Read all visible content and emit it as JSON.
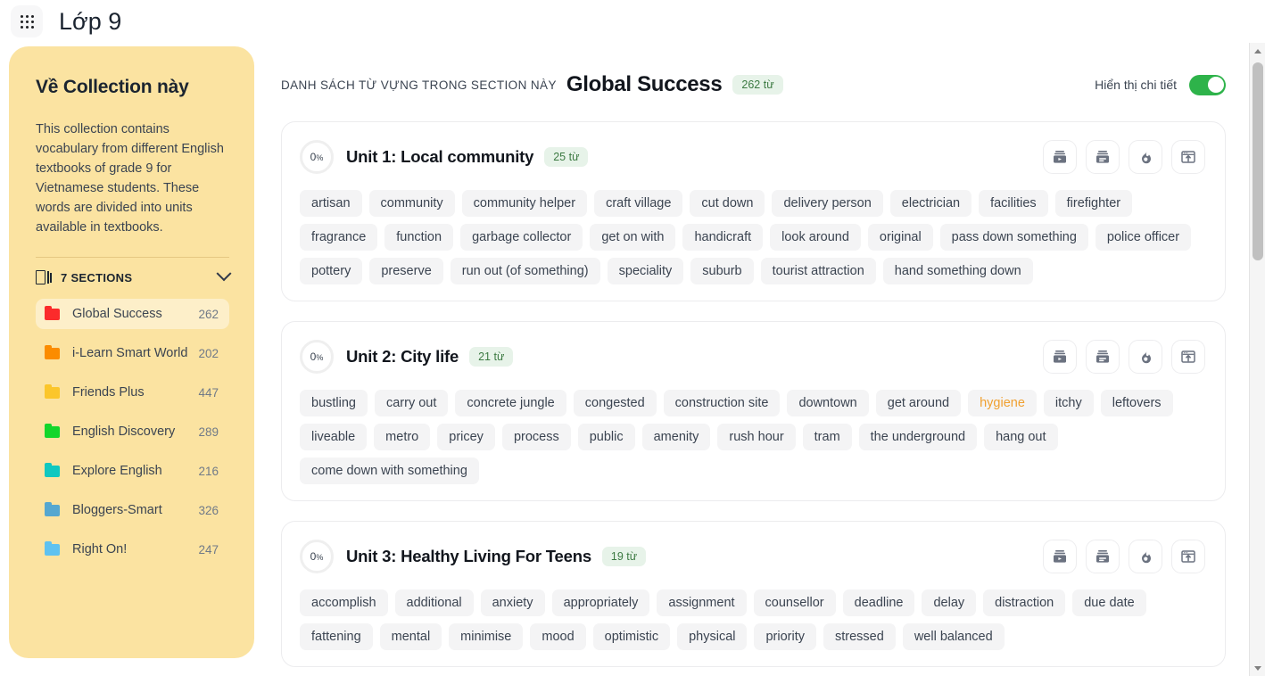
{
  "header": {
    "app_title": "Lớp 9",
    "grid_icon": "grid-apps-icon"
  },
  "sidebar": {
    "title": "Về Collection này",
    "description": "This collection contains vocabulary from different English textbooks of grade 9 for Vietnamese students. These words are divided into units available in textbooks.",
    "sections_label": "7 SECTIONS",
    "sections_icon": "book-sections-icon",
    "chevron_icon": "chevron-down-icon",
    "collections": [
      {
        "name": "Global Success",
        "count": "262",
        "color": "#FB2B2B",
        "active": true
      },
      {
        "name": "i-Learn Smart World",
        "count": "202",
        "color": "#FB8C00",
        "active": false
      },
      {
        "name": "Friends Plus",
        "count": "447",
        "color": "#FBC62B",
        "active": false
      },
      {
        "name": "English Discovery",
        "count": "289",
        "color": "#13D62B",
        "active": false
      },
      {
        "name": "Explore English",
        "count": "216",
        "color": "#10C8C0",
        "active": false
      },
      {
        "name": "Bloggers-Smart",
        "count": "326",
        "color": "#55A7D0",
        "active": false
      },
      {
        "name": "Right On!",
        "count": "247",
        "color": "#5FC2F0",
        "active": false
      }
    ]
  },
  "main": {
    "kicker": "DANH SÁCH TỪ VỰNG TRONG SECTION NÀY",
    "title": "Global Success",
    "word_count_badge": "262 từ",
    "detail_toggle_label": "Hiển thị chi tiết",
    "detail_toggle_on": true,
    "accent_green": "#2EB34A",
    "badge_green_bg": "#E7F3E9",
    "badge_green_text": "#3C7A42",
    "warn_color": "#F0A030",
    "actions": [
      {
        "icon": "flashcard-play-icon"
      },
      {
        "icon": "card-stack-icon"
      },
      {
        "icon": "flame-icon"
      },
      {
        "icon": "export-window-icon"
      }
    ],
    "units": [
      {
        "progress": "0",
        "progress_suffix": "%",
        "title": "Unit 1: Local community",
        "word_count_badge": "25 từ",
        "words": [
          {
            "text": "artisan",
            "state": "default"
          },
          {
            "text": "community",
            "state": "default"
          },
          {
            "text": "community helper",
            "state": "default"
          },
          {
            "text": "craft village",
            "state": "default"
          },
          {
            "text": "cut down",
            "state": "default"
          },
          {
            "text": "delivery person",
            "state": "default"
          },
          {
            "text": "electrician",
            "state": "default"
          },
          {
            "text": "facilities",
            "state": "default"
          },
          {
            "text": "firefighter",
            "state": "default"
          },
          {
            "text": "fragrance",
            "state": "default"
          },
          {
            "text": "function",
            "state": "default"
          },
          {
            "text": "garbage collector",
            "state": "default"
          },
          {
            "text": "get on with",
            "state": "default"
          },
          {
            "text": "handicraft",
            "state": "default"
          },
          {
            "text": "look around",
            "state": "default"
          },
          {
            "text": "original",
            "state": "default"
          },
          {
            "text": "pass down something",
            "state": "default"
          },
          {
            "text": "police officer",
            "state": "default"
          },
          {
            "text": "pottery",
            "state": "default"
          },
          {
            "text": "preserve",
            "state": "default"
          },
          {
            "text": "run out (of something)",
            "state": "default"
          },
          {
            "text": "speciality",
            "state": "default"
          },
          {
            "text": "suburb",
            "state": "default"
          },
          {
            "text": "tourist attraction",
            "state": "default"
          },
          {
            "text": "hand something down",
            "state": "default"
          }
        ]
      },
      {
        "progress": "0",
        "progress_suffix": "%",
        "title": "Unit 2: City life",
        "word_count_badge": "21 từ",
        "words": [
          {
            "text": "bustling",
            "state": "default"
          },
          {
            "text": "carry out",
            "state": "default"
          },
          {
            "text": "concrete jungle",
            "state": "default"
          },
          {
            "text": "congested",
            "state": "default"
          },
          {
            "text": "construction site",
            "state": "default"
          },
          {
            "text": "downtown",
            "state": "default"
          },
          {
            "text": "get around",
            "state": "default"
          },
          {
            "text": "hygiene",
            "state": "warn"
          },
          {
            "text": "itchy",
            "state": "default"
          },
          {
            "text": "leftovers",
            "state": "default"
          },
          {
            "text": "liveable",
            "state": "default"
          },
          {
            "text": "metro",
            "state": "default"
          },
          {
            "text": "pricey",
            "state": "default"
          },
          {
            "text": "process",
            "state": "default"
          },
          {
            "text": "public",
            "state": "default"
          },
          {
            "text": "amenity",
            "state": "default"
          },
          {
            "text": "rush hour",
            "state": "default"
          },
          {
            "text": "tram",
            "state": "default"
          },
          {
            "text": "the underground",
            "state": "default"
          },
          {
            "text": "hang out",
            "state": "default"
          },
          {
            "text": "come down with something",
            "state": "default"
          }
        ]
      },
      {
        "progress": "0",
        "progress_suffix": "%",
        "title": "Unit 3: Healthy Living For Teens",
        "word_count_badge": "19 từ",
        "words": [
          {
            "text": "accomplish",
            "state": "default"
          },
          {
            "text": "additional",
            "state": "default"
          },
          {
            "text": "anxiety",
            "state": "default"
          },
          {
            "text": "appropriately",
            "state": "default"
          },
          {
            "text": "assignment",
            "state": "default"
          },
          {
            "text": "counsellor",
            "state": "default"
          },
          {
            "text": "deadline",
            "state": "default"
          },
          {
            "text": "delay",
            "state": "default"
          },
          {
            "text": "distraction",
            "state": "default"
          },
          {
            "text": "due date",
            "state": "default"
          },
          {
            "text": "fattening",
            "state": "default"
          },
          {
            "text": "mental",
            "state": "default"
          },
          {
            "text": "minimise",
            "state": "default"
          },
          {
            "text": "mood",
            "state": "default"
          },
          {
            "text": "optimistic",
            "state": "default"
          },
          {
            "text": "physical",
            "state": "default"
          },
          {
            "text": "priority",
            "state": "default"
          },
          {
            "text": "stressed",
            "state": "default"
          },
          {
            "text": "well balanced",
            "state": "default"
          }
        ]
      }
    ]
  },
  "scrollbar": {
    "up_icon": "scroll-up-arrow-icon",
    "down_icon": "scroll-down-arrow-icon"
  }
}
